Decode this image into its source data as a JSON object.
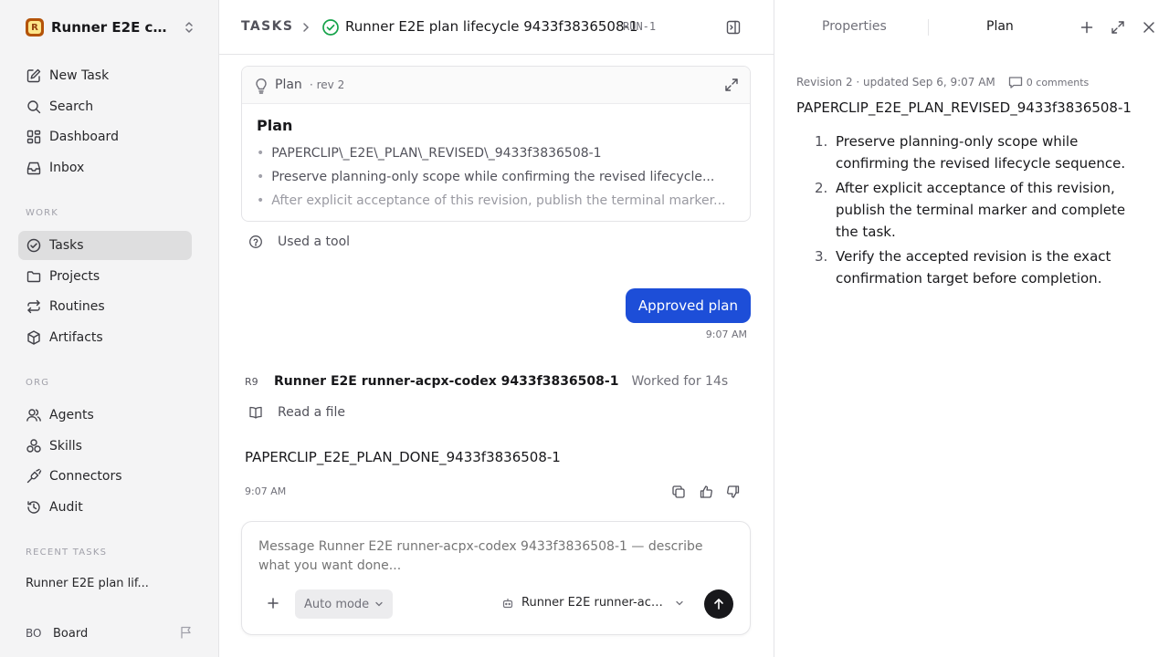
{
  "workspace": {
    "initial": "R",
    "name": "Runner E2E co..."
  },
  "nav": {
    "new_task": "New Task",
    "search": "Search",
    "dashboard": "Dashboard",
    "inbox": "Inbox"
  },
  "sections": {
    "work": "WORK",
    "org": "ORG",
    "recent": "RECENT TASKS"
  },
  "work_items": {
    "tasks": "Tasks",
    "projects": "Projects",
    "routines": "Routines",
    "artifacts": "Artifacts"
  },
  "org_items": {
    "agents": "Agents",
    "skills": "Skills",
    "connectors": "Connectors",
    "audit": "Audit"
  },
  "recent_task": "Runner E2E plan lif...",
  "board": {
    "initials": "BO",
    "label": "Board"
  },
  "breadcrumb": {
    "root": "TASKS",
    "title": "Runner E2E plan lifecycle 9433f3836508-1",
    "id": "RUN-1"
  },
  "plan_card": {
    "label": "Plan",
    "revision": "· rev 2",
    "heading": "Plan",
    "items": [
      "PAPERCLIP\\_E2E\\_PLAN\\_REVISED\\_9433f3836508-1",
      "Preserve planning-only scope while confirming the revised lifecycle...",
      "After explicit acceptance of this revision, publish the terminal marker..."
    ]
  },
  "tool_used": "Used a tool",
  "user_message": {
    "text": "Approved plan",
    "time": "9:07 AM"
  },
  "agent_message": {
    "avatar": "R9",
    "name": "Runner E2E runner-acpx-codex 9433f3836508-1",
    "worked": "Worked for 14s",
    "action": "Read a file",
    "text": "PAPERCLIP_E2E_PLAN_DONE_9433f3836508-1",
    "time": "9:07 AM"
  },
  "composer": {
    "placeholder": "Message Runner E2E runner-acpx-codex 9433f3836508-1 — describe what you want done...",
    "mode": "Auto mode",
    "agent": "Runner E2E runner-acpx..."
  },
  "right_panel": {
    "tabs": {
      "properties": "Properties",
      "plan": "Plan"
    },
    "revision_meta": "Revision 2 · updated Sep 6, 9:07 AM",
    "comments": "0 comments",
    "plan_id": "PAPERCLIP_E2E_PLAN_REVISED_9433f3836508-1",
    "steps": [
      {
        "num": "1.",
        "text": "Preserve planning-only scope while confirming the revised lifecycle sequence."
      },
      {
        "num": "2.",
        "text": "After explicit acceptance of this revision, publish the terminal marker and complete the task."
      },
      {
        "num": "3.",
        "text": "Verify the accepted revision is the exact confirmation target before completion."
      }
    ]
  },
  "colors": {
    "accent": "#1d4ed8",
    "success": "#16a34a",
    "sidebar_bg": "#f4f4f5",
    "workspace_logo": "#b45309"
  }
}
